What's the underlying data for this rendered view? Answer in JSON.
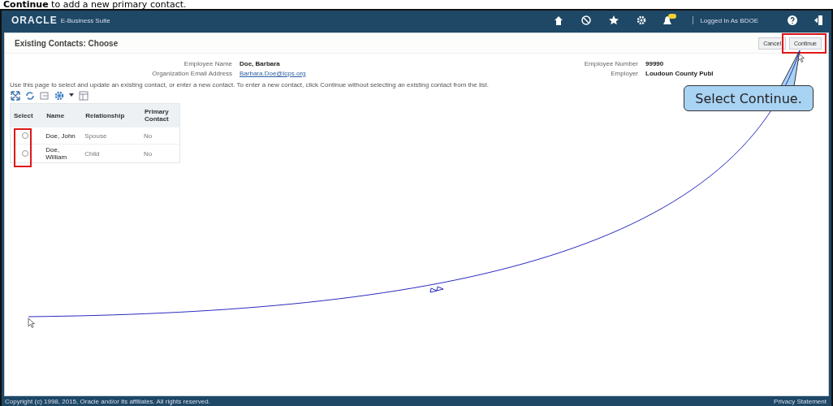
{
  "caption": "**Continue** to add a new primary contact.",
  "header": {
    "logo": "ORACLE",
    "product": "E-Business Suite",
    "user_label": "Logged In As BDOE"
  },
  "page": {
    "title": "Existing Contacts: Choose",
    "buttons": [
      "Cancel",
      "Continue"
    ],
    "fields_left": [
      {
        "label": "Employee Name",
        "value": "Doe, Barbara",
        "kind": "text"
      },
      {
        "label": "Organization Email Address",
        "value": "Barbara.Doe@lcps.org",
        "kind": "link"
      }
    ],
    "fields_right": [
      {
        "label": "Employee Number",
        "value": "99990"
      },
      {
        "label": "Employer",
        "value": "Loudoun County Publ"
      }
    ],
    "instruction": "Use this page to select and update an existing contact, or enter a new contact. To enter a new contact, click Continue without selecting an existing contact from the list."
  },
  "table": {
    "columns": [
      "Select",
      "Name",
      "Relationship",
      "Primary Contact"
    ],
    "rows": [
      {
        "selected": false,
        "name": "Doe, John",
        "relationship": "Spouse",
        "primary": "No"
      },
      {
        "selected": false,
        "name": "Doe, William",
        "relationship": "Child",
        "primary": "No"
      }
    ]
  },
  "callout": "Select Continue.",
  "footer": {
    "copyright": "Copyright (c) 1998, 2015, Oracle and/or its affiliates. All rights reserved.",
    "link": "Privacy Statement"
  }
}
